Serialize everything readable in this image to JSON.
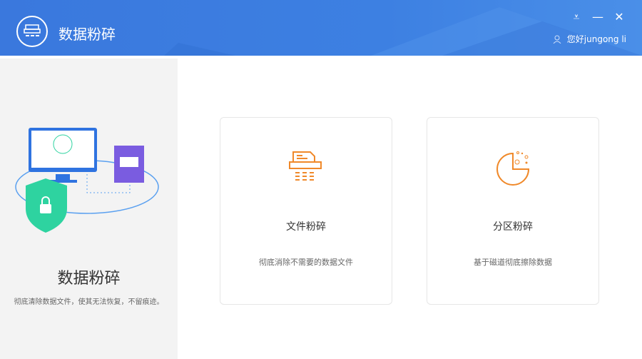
{
  "app": {
    "title": "数据粉碎",
    "greeting": "您好jungong li"
  },
  "window_controls": {
    "menu": "⩡",
    "minimize": "—",
    "close": "✕"
  },
  "left_panel": {
    "title": "数据粉碎",
    "description": "彻底清除数据文件，使其无法恢复，不留痕迹。"
  },
  "cards": [
    {
      "name": "文件粉碎",
      "description": "彻底消除不需要的数据文件",
      "icon": "file-shredder-icon"
    },
    {
      "name": "分区粉碎",
      "description": "基于磁道彻底擦除数据",
      "icon": "partition-pie-icon"
    }
  ],
  "colors": {
    "header": "#3b7bdf",
    "accent": "#f0892a",
    "shield": "#2ed3a0"
  }
}
